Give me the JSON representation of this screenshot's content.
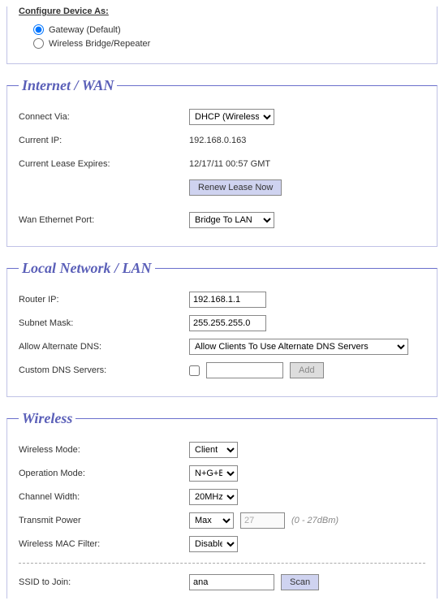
{
  "config": {
    "title": "Configure Device As:",
    "options": [
      {
        "label": "Gateway (Default)",
        "selected": true
      },
      {
        "label": "Wireless Bridge/Repeater",
        "selected": false
      }
    ]
  },
  "wan": {
    "legend": "Internet / WAN",
    "connect_via_label": "Connect Via:",
    "connect_via_value": "DHCP (Wireless)",
    "current_ip_label": "Current IP:",
    "current_ip_value": "192.168.0.163",
    "lease_expires_label": "Current Lease Expires:",
    "lease_expires_value": "12/17/11 00:57 GMT",
    "renew_button": "Renew Lease Now",
    "wan_port_label": "Wan Ethernet Port:",
    "wan_port_value": "Bridge To LAN"
  },
  "lan": {
    "legend": "Local Network / LAN",
    "router_ip_label": "Router IP:",
    "router_ip_value": "192.168.1.1",
    "subnet_label": "Subnet Mask:",
    "subnet_value": "255.255.255.0",
    "alt_dns_label": "Allow Alternate DNS:",
    "alt_dns_value": "Allow Clients To Use Alternate DNS Servers",
    "custom_dns_label": "Custom DNS Servers:",
    "custom_dns_input": "",
    "add_button": "Add"
  },
  "wireless": {
    "legend": "Wireless",
    "mode_label": "Wireless Mode:",
    "mode_value": "Client",
    "op_mode_label": "Operation Mode:",
    "op_mode_value": "N+G+B",
    "ch_width_label": "Channel Width:",
    "ch_width_value": "20MHz",
    "tx_power_label": "Transmit Power",
    "tx_power_value": "Max",
    "tx_power_num": "27",
    "tx_power_hint": "(0 - 27dBm)",
    "mac_filter_label": "Wireless MAC Filter:",
    "mac_filter_value": "Disabled",
    "ssid_label": "SSID to Join:",
    "ssid_value": "ana",
    "scan_button": "Scan"
  }
}
